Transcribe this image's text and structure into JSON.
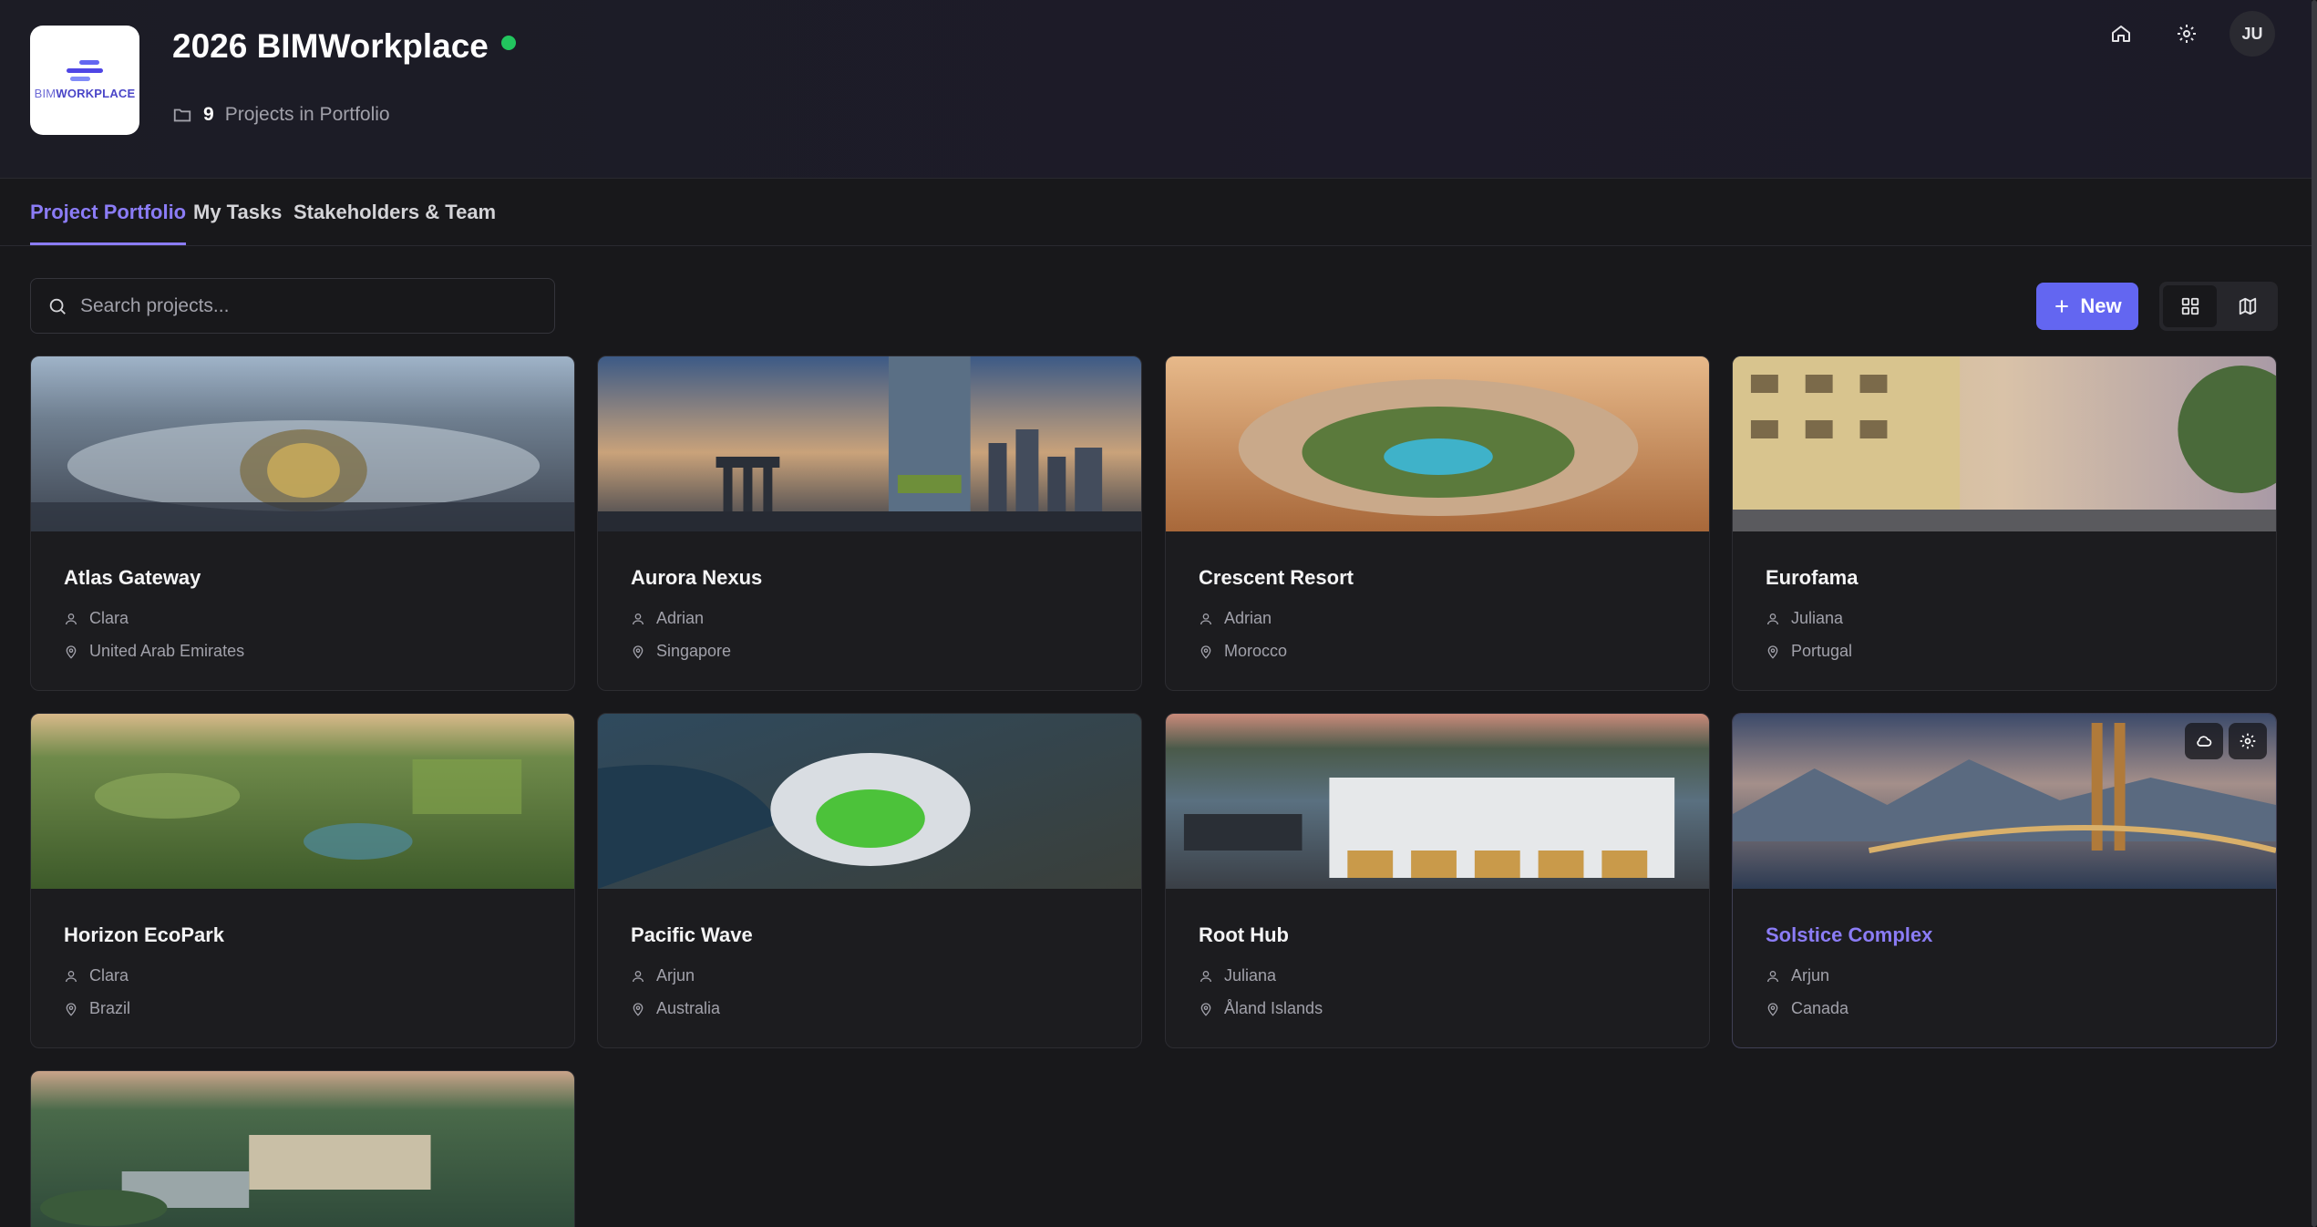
{
  "header": {
    "logo": {
      "text_light": "BIM",
      "text_bold": "WORKPLACE"
    },
    "title": "2026 BIMWorkplace",
    "status_color": "#22c55e",
    "project_count": "9",
    "project_count_label": "Projects in Portfolio",
    "avatar_initials": "JU"
  },
  "tabs": [
    "Project Portfolio",
    "My Tasks",
    "Stakeholders & Team"
  ],
  "toolbar": {
    "search_placeholder": "Search projects...",
    "new_label": "New"
  },
  "accent_color": "#6366f1",
  "projects": [
    {
      "name": "Atlas Gateway",
      "owner": "Clara",
      "location": "United Arab Emirates"
    },
    {
      "name": "Aurora Nexus",
      "owner": "Adrian",
      "location": "Singapore"
    },
    {
      "name": "Crescent Resort",
      "owner": "Adrian",
      "location": "Morocco"
    },
    {
      "name": "Eurofama",
      "owner": "Juliana",
      "location": "Portugal"
    },
    {
      "name": "Horizon EcoPark",
      "owner": "Clara",
      "location": "Brazil"
    },
    {
      "name": "Pacific Wave",
      "owner": "Arjun",
      "location": "Australia"
    },
    {
      "name": "Root Hub",
      "owner": "Juliana",
      "location": "Åland Islands"
    },
    {
      "name": "Solstice Complex",
      "owner": "Arjun",
      "location": "Canada"
    }
  ]
}
